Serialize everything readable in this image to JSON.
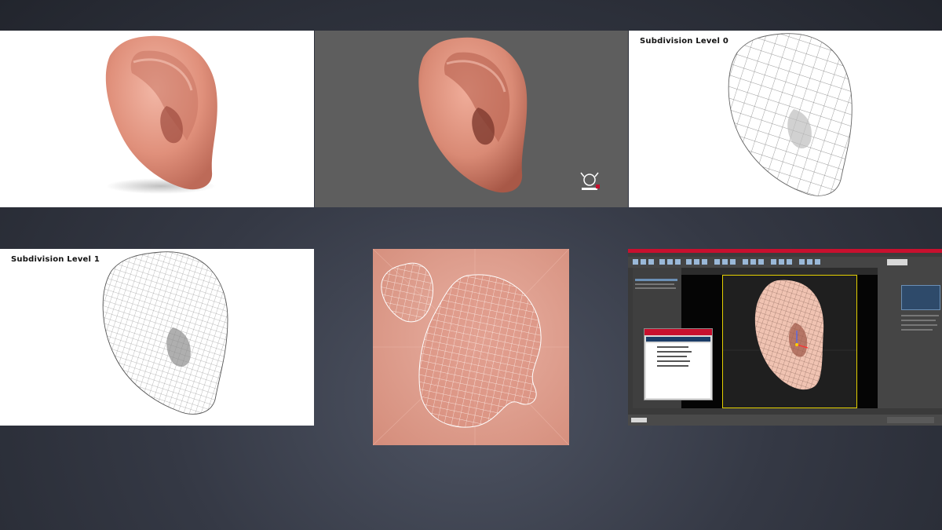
{
  "panels": {
    "render_white": {},
    "render_grey": {},
    "wire_level0": {
      "caption": "Subdivision Level 0"
    },
    "wire_level1": {
      "caption": "Subdivision Level 1"
    },
    "uv_layout": {},
    "max_viewport": {}
  },
  "colors": {
    "skin": "#e39a86",
    "skin_shadow": "#b8604f",
    "wire": "#6a6a6a",
    "uv_bg": "#e3a596",
    "max_titlebar": "#c8102e",
    "max_viewport_border": "#e4d000"
  },
  "icons": {
    "watermark": "horns-logo-icon"
  }
}
